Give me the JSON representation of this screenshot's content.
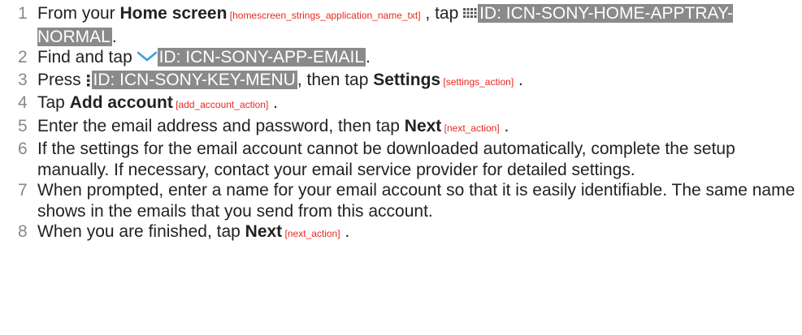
{
  "title_fragment": "",
  "steps": [
    {
      "num": "1",
      "t1": "From your ",
      "b1": "Home screen",
      "ref1": " [homescreen_strings_application_name_txt]",
      "t2": " , tap ",
      "icon1": "apptray-grid-icon",
      "hl1": "ID: ICN-SONY-HOME-APPTRAY-NORMAL",
      "t3": "."
    },
    {
      "num": "2",
      "t1": "Find and tap ",
      "icon1": "email-envelope-icon",
      "hl1": "ID: ICN-SONY-APP-EMAIL",
      "t2": "."
    },
    {
      "num": "3",
      "t1": "Press ",
      "icon1": "menu-key-icon",
      "hl1": "ID: ICN-SONY-KEY-MENU",
      "t2": ", then tap ",
      "b1": "Settings",
      "ref1": " [settings_action]",
      "t3": " ."
    },
    {
      "num": "4",
      "t1": "Tap ",
      "b1": "Add account",
      "ref1": " [add_account_action]",
      "t2": " ."
    },
    {
      "num": "5",
      "t1": "Enter the email address and password, then tap ",
      "b1": "Next",
      "ref1": " [next_action]",
      "t2": " ."
    },
    {
      "num": "6",
      "text": "If the settings for the email account cannot be downloaded automatically, complete the setup manually. If necessary, contact your email service provider for detailed settings."
    },
    {
      "num": "7",
      "text": "When prompted, enter a name for your email account so that it is easily identifiable. The same name shows in the emails that you send from this account."
    },
    {
      "num": "8",
      "t1": "When you are finished, tap ",
      "b1": "Next",
      "ref1": " [next_action]",
      "t2": " ."
    }
  ],
  "colors": {
    "reference_red": "#e8281e",
    "id_highlight_bg": "#8a8a8a",
    "step_number": "#888888",
    "title_blue": "#1aa3d9",
    "icon_blue": "#3aa0d8"
  }
}
